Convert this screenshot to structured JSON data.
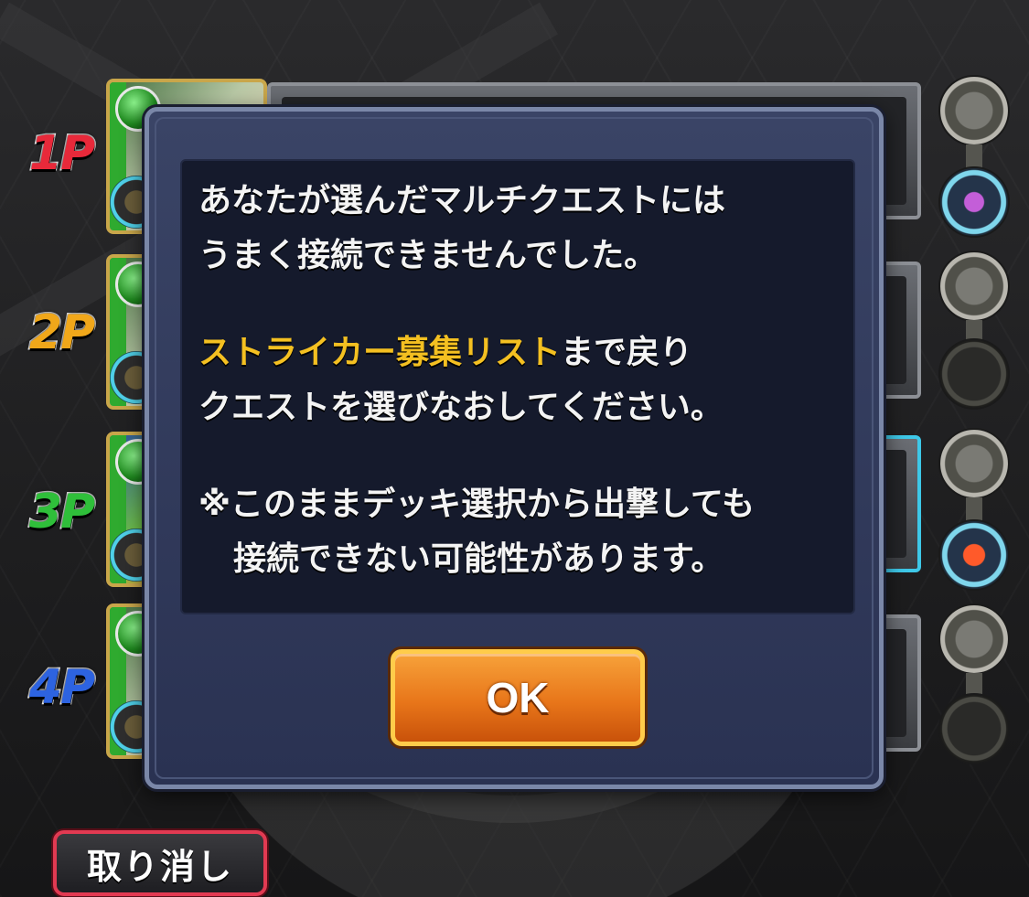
{
  "players": [
    {
      "label": "1P",
      "color": "#e8293a"
    },
    {
      "label": "2P",
      "color": "#f0a71a"
    },
    {
      "label": "3P",
      "color": "#2fbf3a"
    },
    {
      "label": "4P",
      "color": "#2d63e0"
    }
  ],
  "dialog": {
    "line1": "あなたが選んだマルチクエストには",
    "line2": "うまく接続できませんでした。",
    "line3_highlight": "ストライカー募集リスト",
    "line3_rest": "まで戻り",
    "line4": "クエストを選びなおしてください。",
    "line5": "※このままデッキ選択から出撃しても",
    "line6": "接続できない可能性があります。",
    "ok_label": "OK"
  },
  "footer": {
    "cancel_label": "取り消し"
  },
  "colors": {
    "highlight": "#f4c021",
    "ok_button": "#e8761a",
    "cancel_border": "#e23a52"
  }
}
